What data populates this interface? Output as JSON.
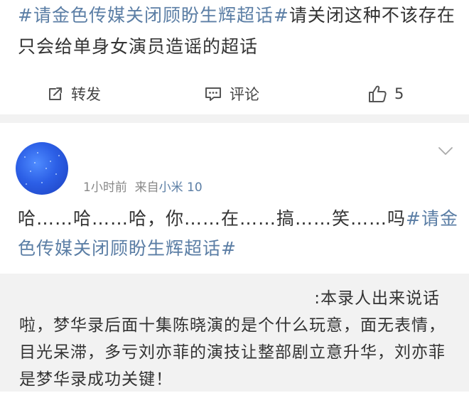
{
  "post1": {
    "topic": "#请金色传媒关闭顾盼生辉超话#",
    "text": "请关闭这种不该存在只会给单身女演员造谣的超话"
  },
  "actions": {
    "repost_label": "转发",
    "comment_label": "评论",
    "like_count": "5"
  },
  "post2": {
    "time": "1小时前",
    "source_prefix": "来自",
    "device": "小米 10",
    "text": "哈……哈……哈，你……在……搞……笑……吗",
    "topic": "#请金色传媒关闭顾盼生辉超话#"
  },
  "quote": {
    "first_line": ":本录人出来说话",
    "body": "啦，梦华录后面十集陈晓演的是个什么玩意，面无表情，目光呆滞，多亏刘亦菲的演技让整部剧立意升华，刘亦菲是梦华录成功关键！"
  },
  "colors": {
    "link": "#5b7ea5",
    "text": "#333333",
    "meta": "#888888",
    "divider": "#f2f2f2",
    "avatar": "#2c5fe6"
  },
  "icons": [
    "repost-icon",
    "comment-icon",
    "like-icon",
    "chevron-down-icon"
  ]
}
